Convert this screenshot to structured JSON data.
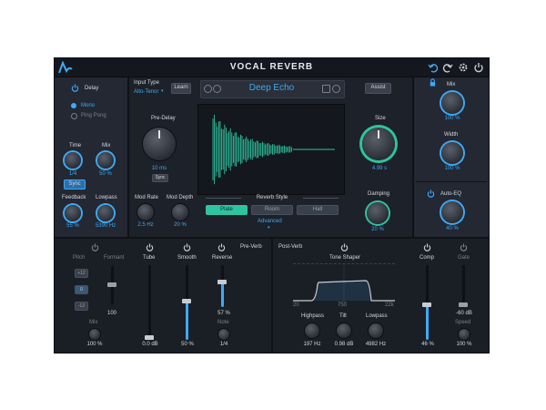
{
  "header": {
    "title": "VOCAL REVERB"
  },
  "delay": {
    "label": "Delay",
    "modes": [
      "Mono",
      "Ping Pong"
    ],
    "time_label": "Time",
    "time_value": "1/4",
    "sync_label": "Sync",
    "mix_label": "Mix",
    "mix_value": "50 %",
    "feedback_label": "Feedback",
    "feedback_value": "55 %",
    "lowpass_label": "Lowpass",
    "lowpass_value": "5390 Hz"
  },
  "preset": {
    "input_type_label": "Input Type",
    "input_type_value": "Alto-Tenor",
    "learn_label": "Learn",
    "name": "Deep Echo",
    "assist_label": "Assist"
  },
  "reverb": {
    "predelay_label": "Pre-Delay",
    "predelay_value": "10 ms",
    "predelay_sync": "Sync",
    "size_label": "Size",
    "size_value": "4.99 s",
    "damping_label": "Damping",
    "damping_value": "20 %",
    "modrate_label": "Mod Rate",
    "modrate_value": "2.5 Hz",
    "moddepth_label": "Mod Depth",
    "moddepth_value": "20 %",
    "style_label": "Reverb Style",
    "styles": [
      "Plate",
      "Room",
      "Hall"
    ],
    "advanced_label": "Advanced"
  },
  "output": {
    "mix_label": "Mix",
    "mix_value": "100 %",
    "width_label": "Width",
    "width_value": "100 %",
    "autoeq_label": "Auto-EQ",
    "autoeq_value": "40 %"
  },
  "prevb": {
    "pitch_label": "Pitch",
    "pitch_buttons": [
      "+12",
      "0",
      "-12"
    ],
    "pitch_mix_label": "Mix",
    "pitch_mix_value": "100 %",
    "formant_label": "Formant",
    "formant_value": "100",
    "tube_label": "Tube",
    "tube_value": "0.0 dB",
    "smooth_label": "Smooth",
    "smooth_value": "50 %",
    "reverse_label": "Reverse",
    "reverse_section": "Pre-Verb",
    "reverse_value": "57 %",
    "note_label": "Note",
    "note_value": "1/4"
  },
  "postvb": {
    "section_label": "Post-Verb",
    "tone_label": "Tone Shaper",
    "freq_ticks": [
      "20",
      "750",
      "22k"
    ],
    "highpass_label": "Highpass",
    "highpass_value": "197 Hz",
    "tilt_label": "Tilt",
    "tilt_value": "0.98 dB",
    "lowpass_label": "Lowpass",
    "lowpass_value": "4982 Hz",
    "comp_label": "Comp",
    "comp_value": "46 %",
    "gate_label": "Gate",
    "gate_value": "-60 dB",
    "speed_label": "Speed",
    "speed_value": "100 %"
  },
  "colors": {
    "accent": "#3fa9f5",
    "teal": "#2ec4a0",
    "panel": "#1d2129"
  }
}
